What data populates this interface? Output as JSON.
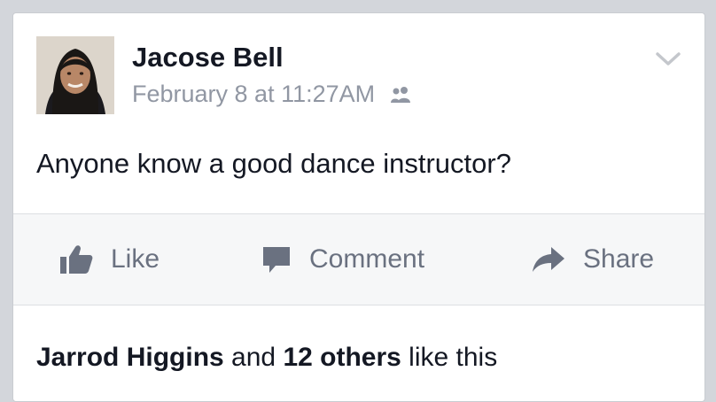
{
  "post": {
    "author": "Jacose Bell",
    "timestamp": "February 8 at 11:27AM",
    "audience_icon": "friends-icon",
    "text": "Anyone know a good dance instructor?"
  },
  "actions": {
    "like_label": "Like",
    "comment_label": "Comment",
    "share_label": "Share"
  },
  "likes": {
    "name": "Jarrod Higgins",
    "connector": " and ",
    "others": "12 others",
    "suffix": " like this"
  },
  "colors": {
    "background": "#d3d6db",
    "text": "#141823",
    "muted": "#9197a3",
    "action": "#6a7180"
  }
}
